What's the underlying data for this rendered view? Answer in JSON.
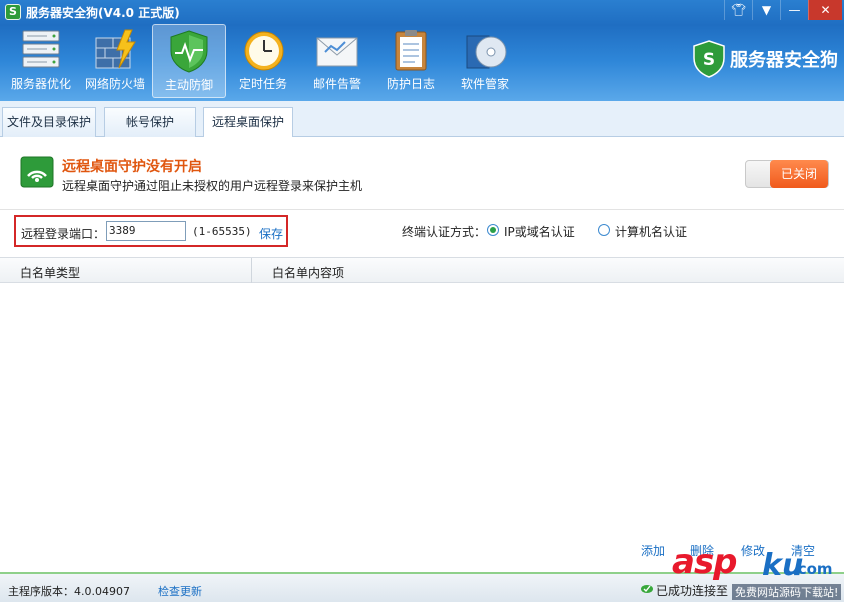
{
  "window": {
    "title": "服务器安全狗(V4.0 正式版)",
    "app_icon_glyph": "S"
  },
  "toolbar": {
    "items": [
      {
        "label": "服务器优化",
        "icon": "server-rack-icon"
      },
      {
        "label": "网络防火墙",
        "icon": "firewall-icon"
      },
      {
        "label": "主动防御",
        "icon": "shield-icon",
        "active": true
      },
      {
        "label": "定时任务",
        "icon": "clock-icon"
      },
      {
        "label": "邮件告警",
        "icon": "mail-icon"
      },
      {
        "label": "防护日志",
        "icon": "clipboard-icon"
      },
      {
        "label": "软件管家",
        "icon": "software-box-icon"
      }
    ],
    "brand_text": "服务器安全狗"
  },
  "tabs": [
    {
      "label": "文件及目录保护"
    },
    {
      "label": "帐号保护"
    },
    {
      "label": "远程桌面保护",
      "active": true
    }
  ],
  "status": {
    "title": "远程桌面守护没有开启",
    "description": "远程桌面守护通过阻止未授权的用户远程登录来保护主机",
    "toggle_label": "已关闭"
  },
  "port": {
    "label": "远程登录端口：",
    "value": "3389",
    "range": "(1-65535)",
    "save_label": "保存"
  },
  "auth": {
    "label": "终端认证方式：",
    "options": [
      {
        "label": "IP或域名认证",
        "selected": true
      },
      {
        "label": "计算机名认证",
        "selected": false
      }
    ]
  },
  "table": {
    "columns": [
      "白名单类型",
      "白名单内容项"
    ]
  },
  "actions": {
    "add": "添加",
    "delete": "删除",
    "modify": "修改",
    "clear": "清空"
  },
  "footer": {
    "version": "主程序版本：4.0.04907",
    "update": "检查更新",
    "connection": "已成功连接至"
  },
  "watermark": {
    "asp": "asp",
    "ku": "ku",
    "net": ".com",
    "sub": "免费网站源码下载站!"
  },
  "colors": {
    "title_bar": "#1f6ec2",
    "accent_orange": "#f05a1c",
    "link_blue": "#1a6fc4",
    "highlight_red": "#d42727"
  }
}
